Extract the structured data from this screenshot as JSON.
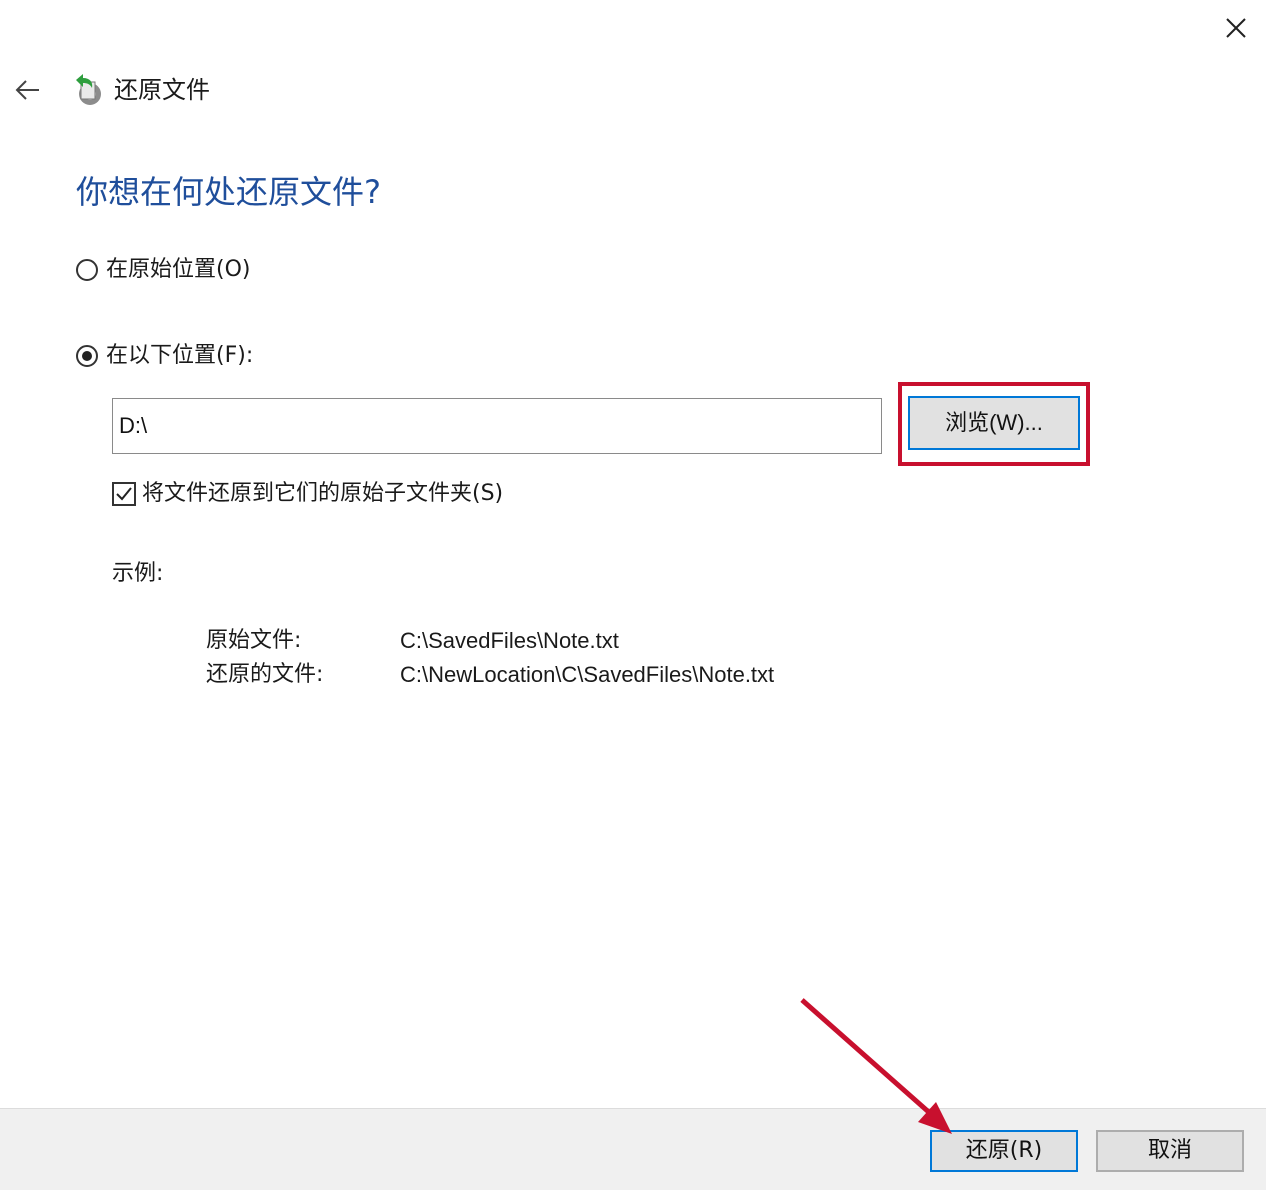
{
  "window": {
    "title": "还原文件"
  },
  "heading": "你想在何处还原文件?",
  "options": {
    "original_label": "在原始位置(O)",
    "original_selected": false,
    "following_label": "在以下位置(F):",
    "following_selected": true
  },
  "path_input": {
    "value": "D:\\"
  },
  "browse_button": "浏览(W)...",
  "subfolder_checkbox": {
    "label": "将文件还原到它们的原始子文件夹(S)",
    "checked": true
  },
  "example": {
    "label": "示例:",
    "rows": [
      {
        "key": "原始文件:",
        "value": "C:\\SavedFiles\\Note.txt"
      },
      {
        "key": "还原的文件:",
        "value": "C:\\NewLocation\\C\\SavedFiles\\Note.txt"
      }
    ]
  },
  "footer": {
    "restore_label": "还原(R)",
    "cancel_label": "取消"
  },
  "colors": {
    "heading": "#1f4e9b",
    "accent": "#0078d7",
    "annotation": "#c8102e"
  },
  "icons": {
    "close": "close-icon",
    "back": "back-arrow-icon",
    "app": "restore-files-icon"
  }
}
